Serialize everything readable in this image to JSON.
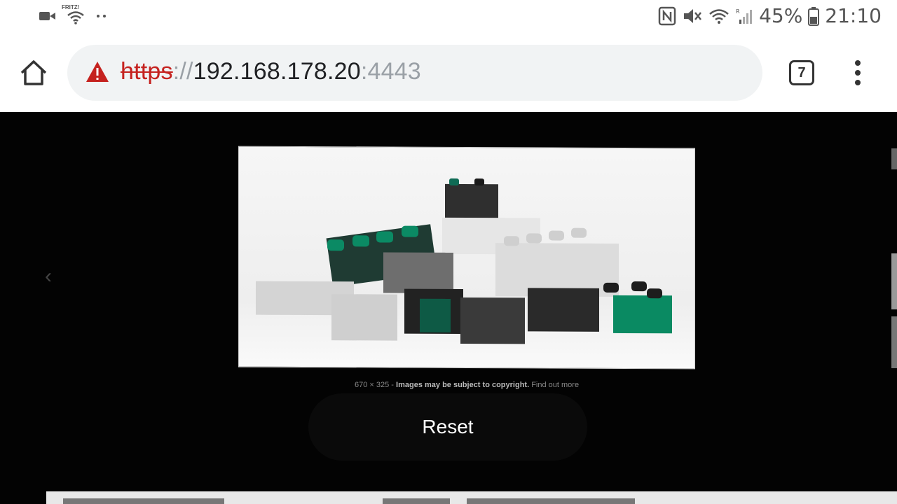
{
  "status_bar": {
    "wifi_label": "FRITZ!",
    "battery": "45%",
    "time": "21:10"
  },
  "browser": {
    "url_scheme": "https",
    "url_separator": "://",
    "url_host": "192.168.178.20",
    "url_port": ":4443",
    "tab_count": "7"
  },
  "viewer": {
    "caption_size": "670 × 325",
    "caption_dash": " - ",
    "caption_copyright": "Images may be subject to copyright.",
    "caption_link": "Find out more",
    "reset_label": "Reset"
  }
}
